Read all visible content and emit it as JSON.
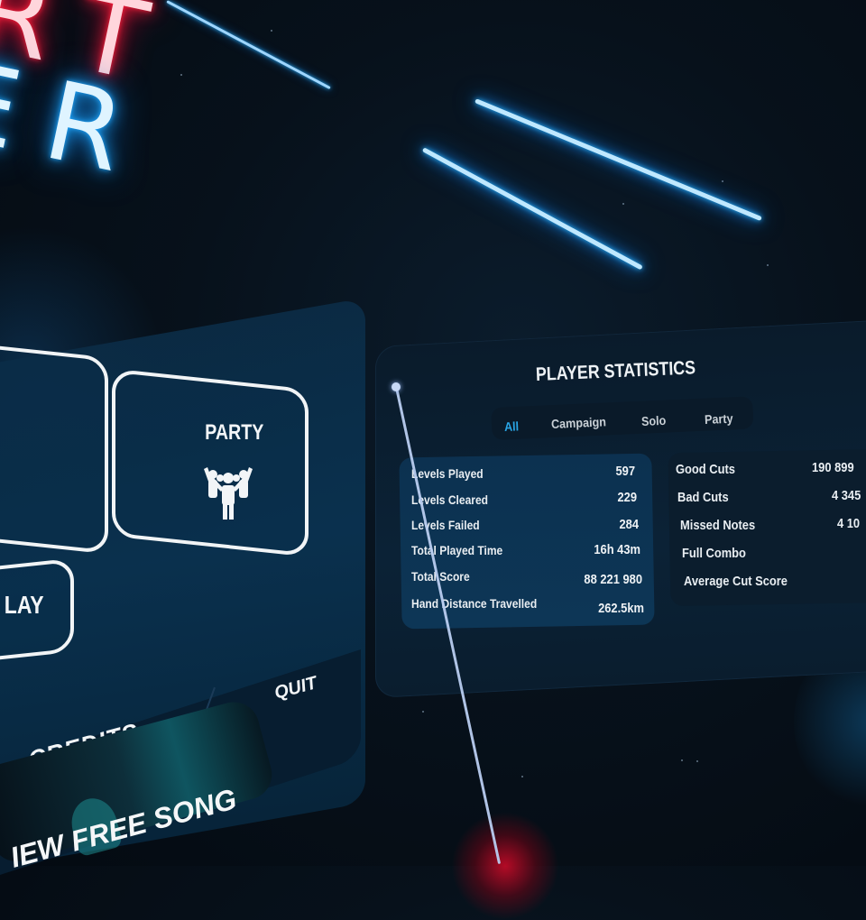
{
  "logo": {
    "line1": "RT",
    "line2": "ER",
    "colors": {
      "top": "#ff1e3c",
      "bottom": "#1ea7ff"
    }
  },
  "main_menu": {
    "tiles": [
      {
        "id": "solo",
        "label": ""
      },
      {
        "id": "party",
        "label": "PARTY",
        "icon": "party-people-icon"
      },
      {
        "id": "online",
        "label": "LAY"
      }
    ],
    "bottom_buttons": {
      "credits": "CREDITS",
      "quit": "QUIT"
    },
    "promo": {
      "label": "NEW FREE SONG",
      "visible_text": "IEW FREE SONG"
    }
  },
  "player_statistics": {
    "title": "PLAYER STATISTICS",
    "tabs": [
      {
        "label": "All",
        "active": true
      },
      {
        "label": "Campaign",
        "active": false
      },
      {
        "label": "Solo",
        "active": false
      },
      {
        "label": "Party",
        "active": false
      }
    ],
    "accent_color": "#29a6e6",
    "left_stats": [
      {
        "label": "Levels Played",
        "value": "597"
      },
      {
        "label": "Levels Cleared",
        "value": "229"
      },
      {
        "label": "Levels Failed",
        "value": "284"
      },
      {
        "label": "Total Played Time",
        "value": "16h 43m"
      },
      {
        "label": "Total Score",
        "value": "88 221 980"
      },
      {
        "label": "Hand Distance Travelled",
        "value": "262.5km"
      }
    ],
    "right_stats": [
      {
        "label": "Good Cuts",
        "value": "190 899"
      },
      {
        "label": "Bad Cuts",
        "value": "4 345"
      },
      {
        "label": "Missed Notes",
        "value": "4 10"
      },
      {
        "label": "Full Combo",
        "value": ""
      },
      {
        "label": "Average Cut Score",
        "value": ""
      }
    ]
  }
}
